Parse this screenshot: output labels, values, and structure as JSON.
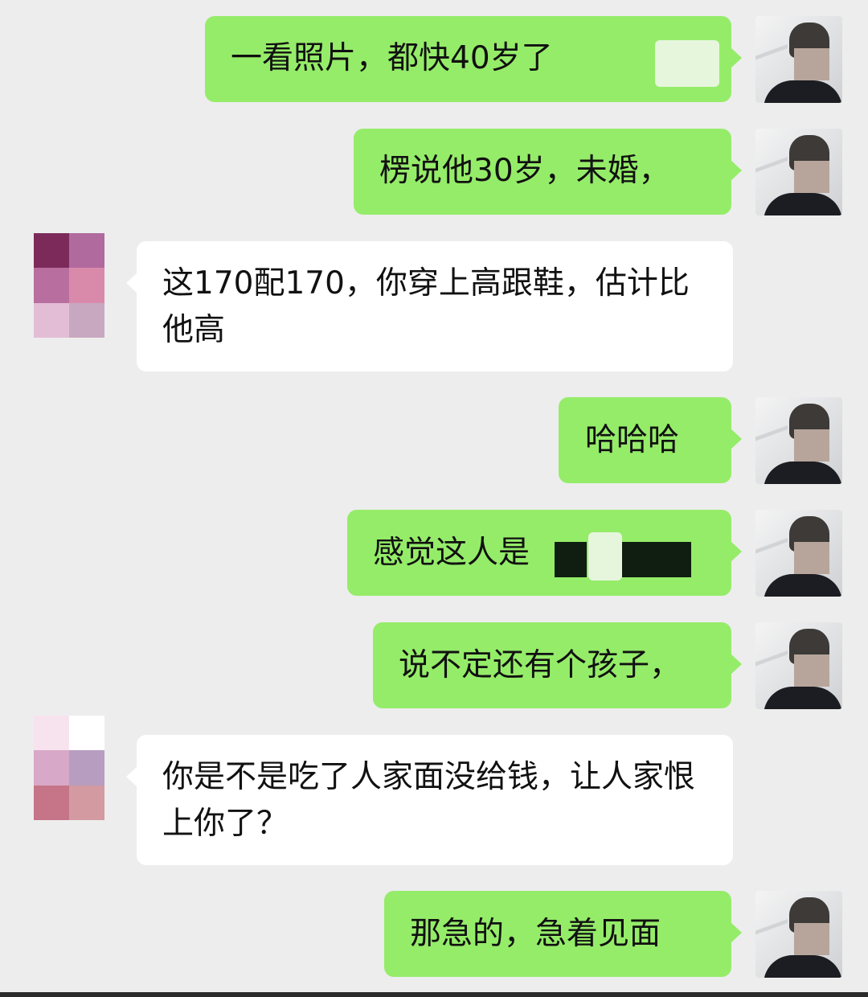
{
  "chat": {
    "messages": [
      {
        "sender": "me",
        "text": "一看照片，都快40岁了"
      },
      {
        "sender": "me",
        "text": "楞说他30岁，未婚，"
      },
      {
        "sender": "other",
        "text": "这170配170，你穿上高跟鞋，估计比他高"
      },
      {
        "sender": "me",
        "text": "哈哈哈"
      },
      {
        "sender": "me",
        "text": "感觉这人是"
      },
      {
        "sender": "me",
        "text": "说不定还有个孩子，"
      },
      {
        "sender": "other",
        "text": "你是不是吃了人家面没给钱，让人家恨上你了？"
      },
      {
        "sender": "me",
        "text": "那急的，急着见面"
      }
    ]
  },
  "colors": {
    "background": "#ededed",
    "my_bubble": "#95ec69",
    "other_bubble": "#ffffff",
    "other_avatar_1": [
      "#7c2a59",
      "#b06a9e",
      "#b86f9f",
      "#d98aab",
      "#e3bdd6",
      "#c8a8c0"
    ],
    "other_avatar_2": [
      "#f7e3ee",
      "#ffffff",
      "#d7a8c7",
      "#b79ec0",
      "#c67488",
      "#d39aa1"
    ]
  },
  "icons": {
    "my_avatar": "user-photo-avatar",
    "other_avatar": "pixelated-mosaic-avatar"
  }
}
